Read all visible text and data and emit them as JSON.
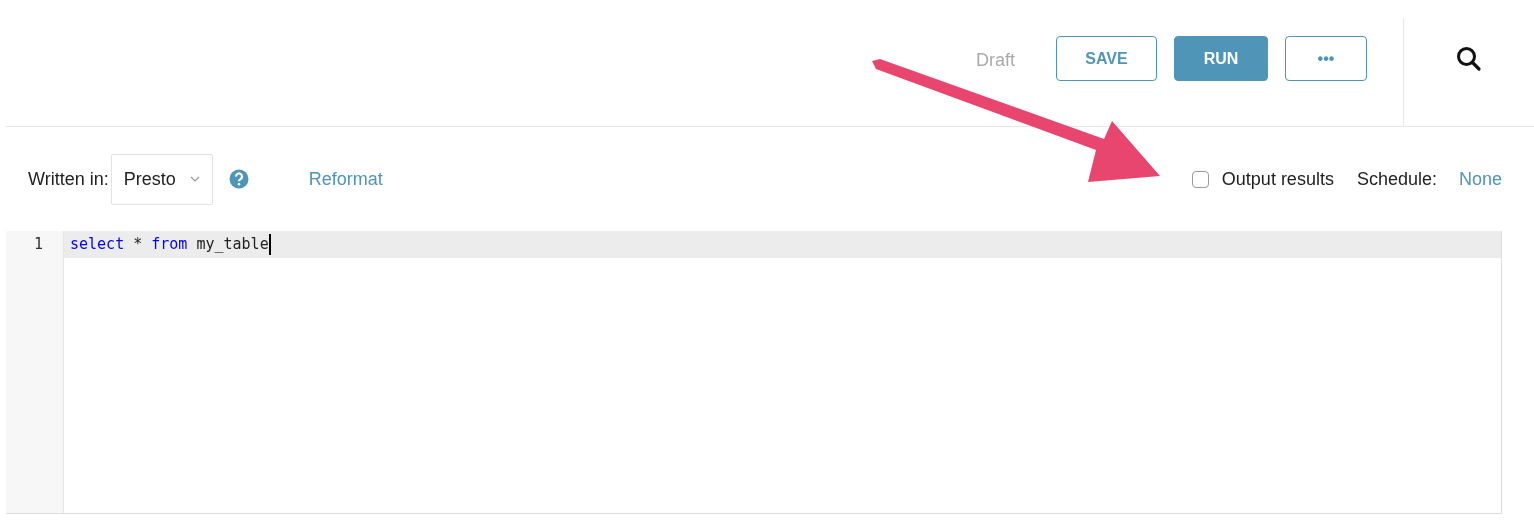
{
  "header": {
    "status": "Draft",
    "buttons": [
      {
        "label": "SAVE",
        "kind": "outline"
      },
      {
        "label": "RUN",
        "kind": "primary"
      },
      {
        "label": "•••",
        "kind": "outline"
      }
    ]
  },
  "toolbar": {
    "language_label": "Written in:",
    "language": "Presto",
    "reformat": "Reformat",
    "output_results": {
      "label": "Output results",
      "checked": false
    },
    "schedule_label": "Schedule:",
    "schedule": "None"
  },
  "editor": {
    "lines": [
      {
        "number": "1",
        "active": true,
        "tokens": [
          {
            "text": "select",
            "kind": "keyword"
          },
          {
            "text": " * ",
            "kind": "plain"
          },
          {
            "text": "from",
            "kind": "keyword"
          },
          {
            "text": " my_table",
            "kind": "plain"
          }
        ]
      }
    ]
  }
}
